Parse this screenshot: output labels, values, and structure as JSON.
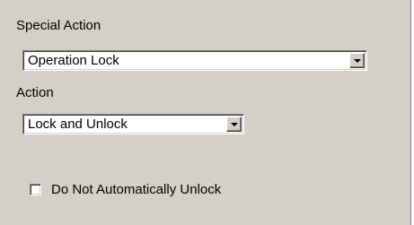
{
  "special_action": {
    "label": "Special Action",
    "selected": "Operation Lock"
  },
  "action": {
    "label": "Action",
    "selected": "Lock and Unlock"
  },
  "auto_unlock": {
    "label": "Do Not Automatically Unlock",
    "checked": false
  },
  "icons": {
    "dropdown": "chevron-down-icon",
    "checkbox": "unchecked-box-icon"
  },
  "colors": {
    "face": "#d4d0c8",
    "field": "#ffffff"
  }
}
